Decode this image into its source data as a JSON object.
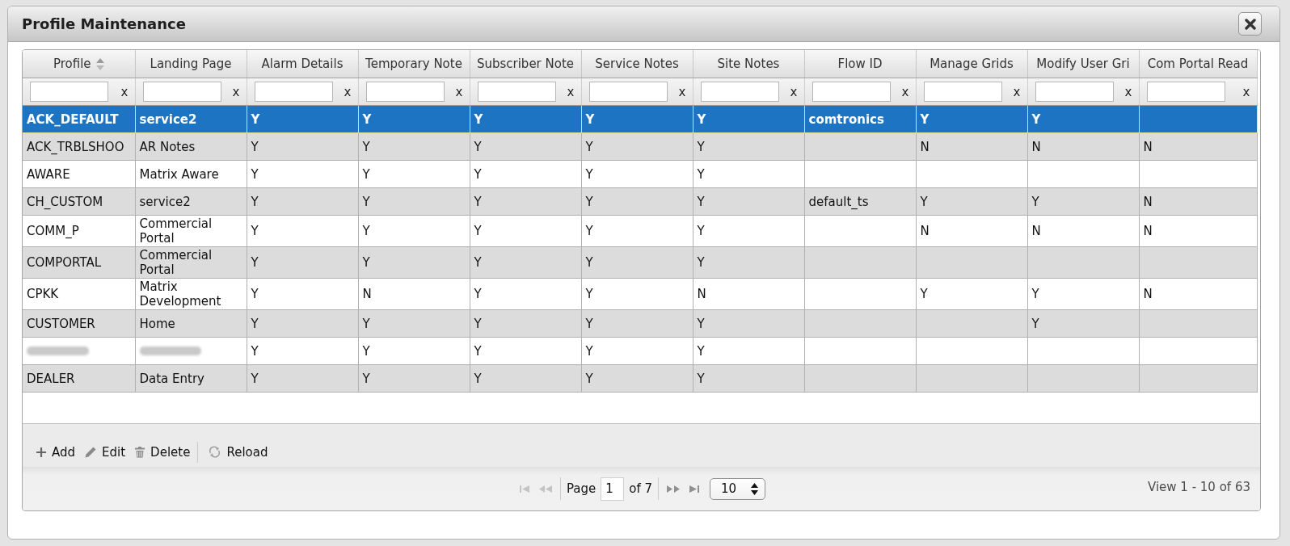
{
  "dialog": {
    "title": "Profile Maintenance"
  },
  "grid": {
    "columns": [
      {
        "label": "Profile",
        "sortable": true,
        "filter_clear": "x"
      },
      {
        "label": "Landing Page",
        "sortable": false,
        "filter_clear": "x"
      },
      {
        "label": "Alarm Details",
        "sortable": false,
        "filter_clear": "x"
      },
      {
        "label": "Temporary Note",
        "sortable": false,
        "filter_clear": "x"
      },
      {
        "label": "Subscriber Note",
        "sortable": false,
        "filter_clear": "x"
      },
      {
        "label": "Service Notes",
        "sortable": false,
        "filter_clear": "x"
      },
      {
        "label": "Site Notes",
        "sortable": false,
        "filter_clear": "x"
      },
      {
        "label": "Flow ID",
        "sortable": false,
        "filter_clear": "x"
      },
      {
        "label": "Manage Grids",
        "sortable": false,
        "filter_clear": "x"
      },
      {
        "label": "Modify User Gri",
        "sortable": false,
        "filter_clear": "x"
      },
      {
        "label": "Com Portal Read",
        "sortable": false,
        "filter_clear": "x"
      }
    ],
    "rows": [
      {
        "selected": true,
        "cells": [
          "ACK_DEFAULT",
          "service2",
          "Y",
          "Y",
          "Y",
          "Y",
          "Y",
          "comtronics",
          "Y",
          "Y",
          null
        ]
      },
      {
        "selected": false,
        "cells": [
          "ACK_TRBLSHOO",
          "AR Notes",
          "Y",
          "Y",
          "Y",
          "Y",
          "Y",
          null,
          "N",
          "N",
          "N"
        ]
      },
      {
        "selected": false,
        "cells": [
          "AWARE",
          "Matrix Aware",
          "Y",
          "Y",
          "Y",
          "Y",
          "Y",
          null,
          null,
          null,
          null
        ]
      },
      {
        "selected": false,
        "cells": [
          "CH_CUSTOM",
          "service2",
          "Y",
          "Y",
          "Y",
          "Y",
          "Y",
          "default_ts",
          "Y",
          "Y",
          "N"
        ]
      },
      {
        "selected": false,
        "cells": [
          "COMM_P",
          "Commercial Portal",
          "Y",
          "Y",
          "Y",
          "Y",
          "Y",
          null,
          "N",
          "N",
          "N"
        ]
      },
      {
        "selected": false,
        "cells": [
          "COMPORTAL",
          "Commercial Portal",
          "Y",
          "Y",
          "Y",
          "Y",
          "Y",
          null,
          null,
          null,
          null
        ]
      },
      {
        "selected": false,
        "cells": [
          "CPKK",
          "Matrix Development",
          "Y",
          "N",
          "Y",
          "Y",
          "N",
          null,
          "Y",
          "Y",
          "N"
        ]
      },
      {
        "selected": false,
        "cells": [
          "CUSTOMER",
          "Home",
          "Y",
          "Y",
          "Y",
          "Y",
          "Y",
          null,
          null,
          "Y",
          null
        ]
      },
      {
        "selected": false,
        "cells": [
          {
            "blurred": true
          },
          {
            "blurred": true
          },
          "Y",
          "Y",
          "Y",
          "Y",
          "Y",
          null,
          null,
          null,
          null
        ]
      },
      {
        "selected": false,
        "cells": [
          "DEALER",
          "Data Entry",
          "Y",
          "Y",
          "Y",
          "Y",
          "Y",
          null,
          null,
          null,
          null
        ]
      }
    ]
  },
  "toolbar": [
    {
      "kind": "add",
      "label": "Add"
    },
    {
      "kind": "edit",
      "label": "Edit"
    },
    {
      "kind": "delete",
      "label": "Delete"
    },
    {
      "kind": "reload",
      "label": "Reload"
    }
  ],
  "pager": {
    "nav": [
      {
        "kind": "first",
        "disabled": true
      },
      {
        "kind": "prev",
        "disabled": true
      },
      {
        "kind": "next",
        "disabled": false
      },
      {
        "kind": "last",
        "disabled": false
      }
    ],
    "page_label": "Page",
    "page": "1",
    "of_label": "of 7",
    "page_size": "10",
    "view_label": "View 1 - 10 of 63"
  }
}
